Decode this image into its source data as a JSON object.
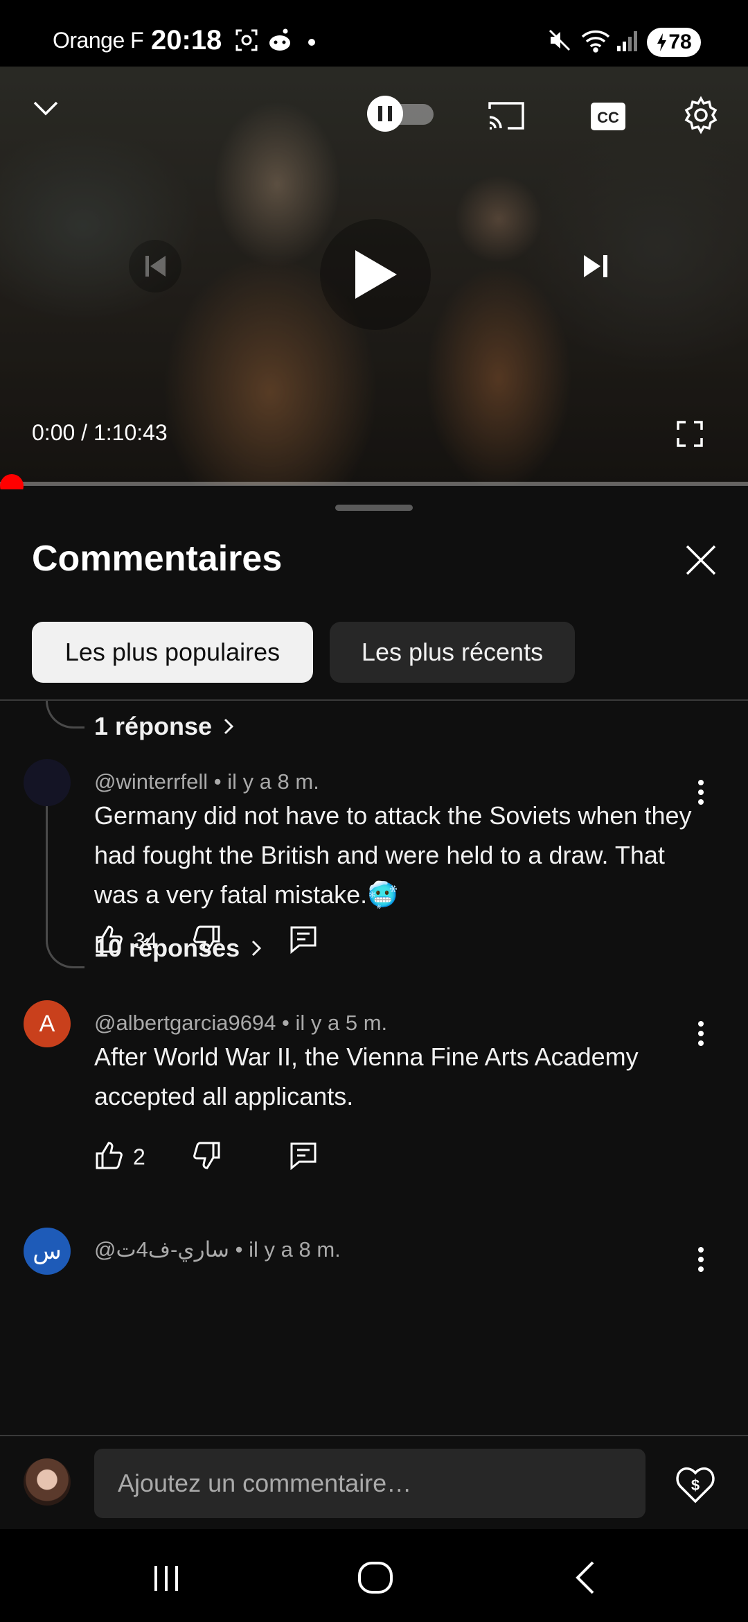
{
  "status_bar": {
    "carrier": "Orange F",
    "time": "20:18",
    "battery": "78"
  },
  "player": {
    "time_display": "0:00 / 1:10:43",
    "progress": 0.0,
    "autoplay": "paused"
  },
  "comments_sheet": {
    "title": "Commentaires",
    "sort_chips": [
      {
        "label": "Les plus populaires",
        "selected": true
      },
      {
        "label": "Les plus récents",
        "selected": false
      }
    ],
    "comments": [
      {
        "reply_link": "1 réponse"
      },
      {
        "author": "@winterrfell",
        "age": "il y a 8 m.",
        "meta": "@winterrfell • il y a 8 m.",
        "text": "Germany did not have to attack the Soviets when they had fought the British and were held to a draw. That was a very fatal mistake.🥶",
        "likes": "34",
        "reply_link": "10 réponses",
        "avatar_color": "#141425"
      },
      {
        "author": "@albertgarcia9694",
        "age": "il y a 5 m.",
        "meta": "@albertgarcia9694 • il y a 5 m.",
        "avatar_letter": "A",
        "avatar_color": "#c9401c",
        "text": "After World War II, the Vienna Fine Arts Academy accepted all applicants.",
        "likes": "2"
      },
      {
        "author": "@ساري-ف4ت",
        "age": "il y a 8 m.",
        "meta": "@ساري-ف4ت • il y a 8 m.",
        "avatar_letter": "س",
        "avatar_color": "#1e5bb8"
      }
    ],
    "input_placeholder": "Ajoutez un commentaire…"
  },
  "colors": {
    "background": "#0f0f0f",
    "progress": "#ff0000",
    "chip_active": "#f1f1f1",
    "chip_inactive": "#272727"
  }
}
